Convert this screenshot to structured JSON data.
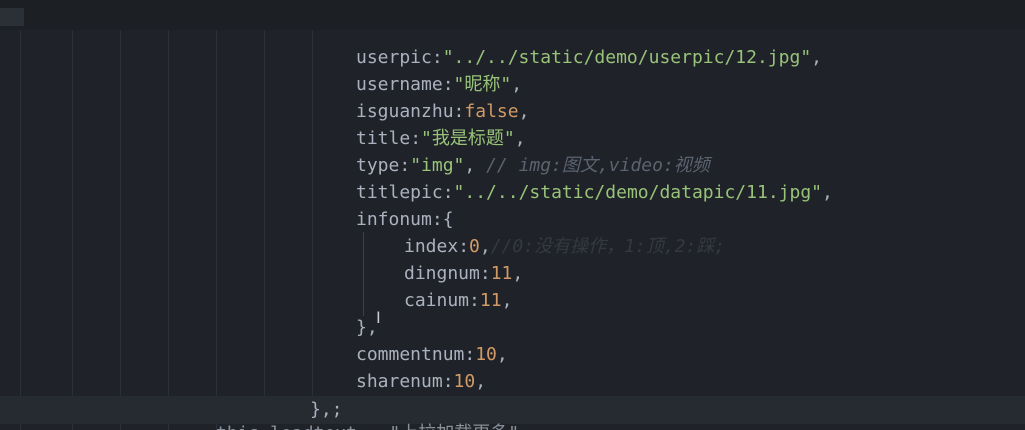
{
  "code": {
    "userpic_key": "userpic",
    "userpic_value": "\"../../static/demo/userpic/12.jpg\"",
    "username_key": "username",
    "username_value": "\"昵称\"",
    "isguanzhu_key": "isguanzhu",
    "isguanzhu_value": "false",
    "title_key": "title",
    "title_value": "\"我是标题\"",
    "type_key": "type",
    "type_value": "\"img\"",
    "type_comment": "// img:图文,video:视频",
    "titlepic_key": "titlepic",
    "titlepic_value": "\"../../static/demo/datapic/11.jpg\"",
    "infonum_key": "infonum",
    "index_key": "index",
    "index_value": "0",
    "index_comment": "//0:没有操作，1:顶,2:踩;",
    "dingnum_key": "dingnum",
    "dingnum_value": "11",
    "cainum_key": "cainum",
    "cainum_value": "11",
    "commentnum_key": "commentnum",
    "commentnum_value": "10",
    "sharenum_key": "sharenum",
    "sharenum_value": "10",
    "closing": "},;",
    "cutoff_line": "this.loadtext = \"上拉加载更多\""
  },
  "cursor_glyph": "I",
  "colors": {
    "background": "#1f2228",
    "string": "#98c379",
    "number": "#d19a66",
    "comment": "#5c6370",
    "text": "#abb2bf"
  }
}
